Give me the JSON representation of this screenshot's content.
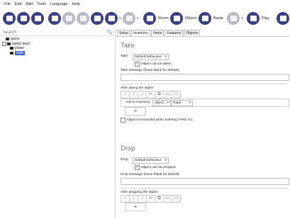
{
  "menu": [
    "File",
    "Edit",
    "Add",
    "Tools",
    "Language",
    "Help"
  ],
  "toolbar": {
    "room_label": "Room",
    "object_label": "Object",
    "back_label": "Back",
    "play_label": "Play"
  },
  "search": {
    "label": "Search"
  },
  "tree": {
    "items": [
      "game",
      "awhip deck",
      "player",
      "rope"
    ]
  },
  "tabs": [
    "Setup",
    "Inventory",
    "Verbs",
    "Features",
    "Objects"
  ],
  "take": {
    "heading": "Take",
    "take_label": "Take:",
    "take_select": "Default behaviour",
    "can_be_taken": "Object can be taken",
    "message_label": "Take message (leave blank for default)",
    "after_label": "After taking the object",
    "add_to_inventory": "Add to inventory",
    "object_select": "object",
    "rope_select": "Rope",
    "exclude_label": "Object is excluded when entering TAKE ALL"
  },
  "drop": {
    "heading": "Drop",
    "drop_label": "Drop:",
    "drop_select": "Default behaviour",
    "can_be_dropped": "Object can be dropped",
    "message_label": "Drop message (leave blank for default)",
    "after_label": "After dropping the object"
  },
  "colors": {
    "accent": "#3a3f88",
    "selection": "#3b66c4"
  }
}
